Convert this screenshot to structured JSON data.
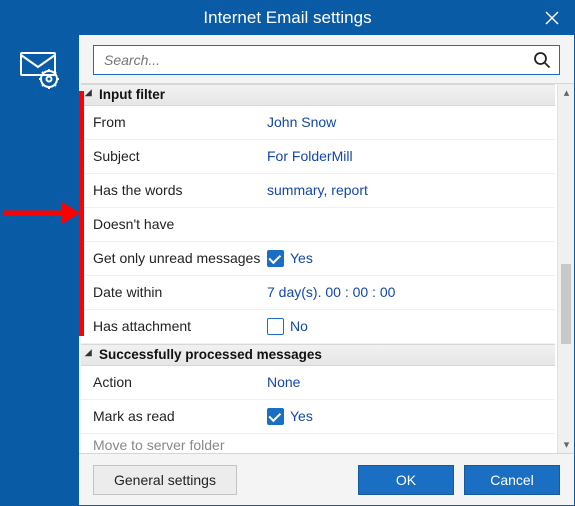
{
  "title": "Internet Email settings",
  "search": {
    "placeholder": "Search..."
  },
  "groups": {
    "input_filter": {
      "header": "Input filter",
      "from_label": "From",
      "from_value": "John Snow",
      "subject_label": "Subject",
      "subject_value": "For FolderMill",
      "haswords_label": "Has the words",
      "haswords_value": "summary, report",
      "doesnt_label": "Doesn't have",
      "doesnt_value": "",
      "unread_label": "Get only unread messages",
      "unread_value": "Yes",
      "datewithin_label": "Date within",
      "datewithin_value": "7 day(s).  00 : 00 : 00",
      "hasatt_label": "Has attachment",
      "hasatt_value": "No"
    },
    "processed": {
      "header": "Successfully processed messages",
      "action_label": "Action",
      "action_value": "None",
      "markread_label": "Mark as read",
      "markread_value": "Yes",
      "move_label": "Move to server folder",
      "move_value": ""
    }
  },
  "footer": {
    "general": "General settings",
    "ok": "OK",
    "cancel": "Cancel"
  }
}
